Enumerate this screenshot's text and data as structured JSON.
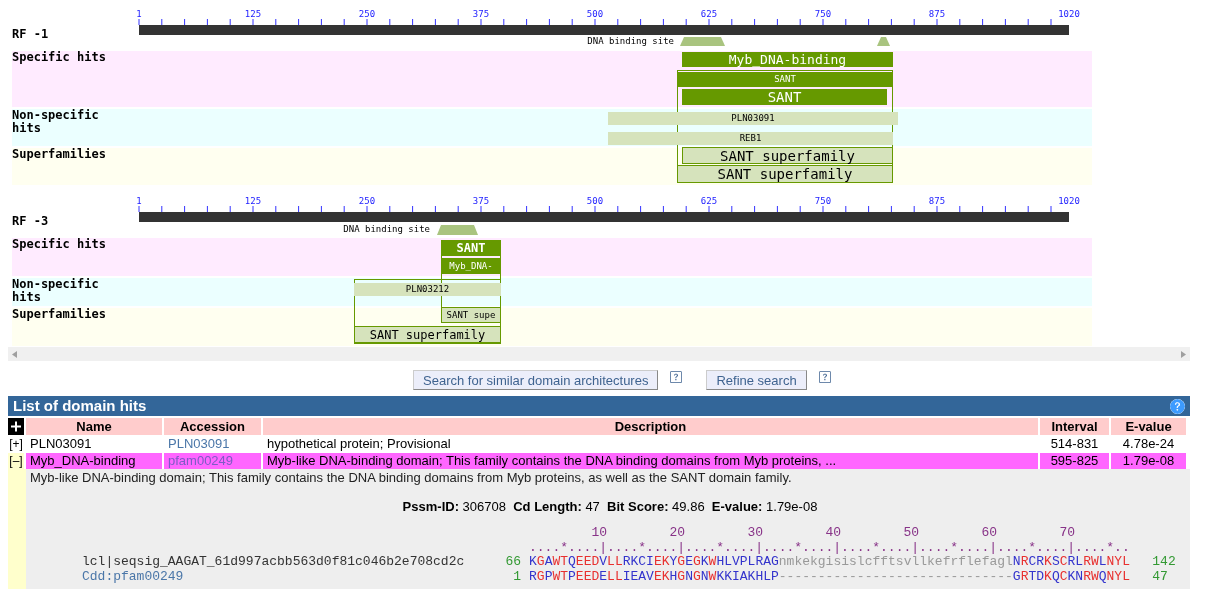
{
  "frames": [
    {
      "label": "RF -1",
      "ticks": [
        "1",
        "125",
        "250",
        "375",
        "500",
        "625",
        "750",
        "875",
        "1020"
      ],
      "site": {
        "label": "DNA binding site"
      },
      "tracks": [
        {
          "label": "Specific hits"
        },
        {
          "label": "Non-specific hits"
        },
        {
          "label": "Superfamilies"
        }
      ],
      "hits": [
        {
          "label": "Myb_DNA-binding",
          "kind": "specific"
        },
        {
          "label": "SANT",
          "kind": "specific"
        },
        {
          "label": "SANT",
          "kind": "specific"
        },
        {
          "label": "PLN03091",
          "kind": "nonspecific"
        },
        {
          "label": "REB1",
          "kind": "nonspecific"
        },
        {
          "label": "SANT superfamily",
          "kind": "superfamily"
        },
        {
          "label": "SANT superfamily",
          "kind": "superfamily"
        }
      ]
    },
    {
      "label": "RF -3",
      "ticks": [
        "1",
        "125",
        "250",
        "375",
        "500",
        "625",
        "750",
        "875",
        "1020"
      ],
      "site": {
        "label": "DNA binding site"
      },
      "tracks": [
        {
          "label": "Specific hits"
        },
        {
          "label": "Non-specific hits"
        },
        {
          "label": "Superfamilies"
        }
      ],
      "hits": [
        {
          "label": "SANT",
          "kind": "specific"
        },
        {
          "label": "Myb_DNA-",
          "kind": "specific"
        },
        {
          "label": "PLN03212",
          "kind": "nonspecific"
        },
        {
          "label": "SANT supe",
          "kind": "superfamily"
        },
        {
          "label": "SANT superfamily",
          "kind": "superfamily"
        }
      ]
    }
  ],
  "buttons": [
    "Search for similar domain architectures",
    "Refine search"
  ],
  "domain_hits": {
    "title": "List of domain hits",
    "columns": [
      "Name",
      "Accession",
      "Description",
      "Interval",
      "E-value"
    ],
    "rows": [
      {
        "toggle": "[+]",
        "name": "PLN03091",
        "accession": "PLN03091",
        "description": "hypothetical protein; Provisional",
        "interval": "514-831",
        "evalue": "4.78e-24",
        "selected": false,
        "expanded": false
      },
      {
        "toggle": "[–]",
        "name": "Myb_DNA-binding",
        "accession": "pfam00249",
        "description": "Myb-like DNA-binding domain; This family contains the DNA binding domains from Myb proteins, ...",
        "interval": "595-825",
        "evalue": "1.79e-08",
        "selected": true,
        "expanded": true,
        "detail": {
          "description": "Myb-like DNA-binding domain; This family contains the DNA binding domains from Myb proteins, as well as the SANT domain family.",
          "stats": "**Pssm-ID:** 306708  **Cd Length:** 47  **Bit Score:** 49.86  **E-value:** 1.79e-08",
          "alignment": {
            "scale_numbers": [
              "10",
              "20",
              "30",
              "40",
              "50",
              "60",
              "70"
            ],
            "scale_marks": "....*....|....*....|....*....|....*....|....*....|....*....|....*....|....*..",
            "rows": [
              {
                "kind": "query",
                "label": "lcl|seqsig_AAGAT_61d997acbb563d0f81c046b2e708cd2c",
                "start": "66",
                "sequence": "KGAWTQEEDVLLRKCIEKYGEGKWHLVPLRAGnmkekgisislcfftsvllkefrflefaglNRCRKSCRLRWLNYL",
                "end": "142"
              },
              {
                "kind": "subject",
                "label": "Cdd:pfam00249",
                "start": "1",
                "sequence": "RGPWTPEEDELLIEAVEKHGNGNWKKIAKHLP------------------------------GRTDKQCKNRWQNYL",
                "end": "47"
              }
            ]
          }
        }
      }
    ]
  }
}
